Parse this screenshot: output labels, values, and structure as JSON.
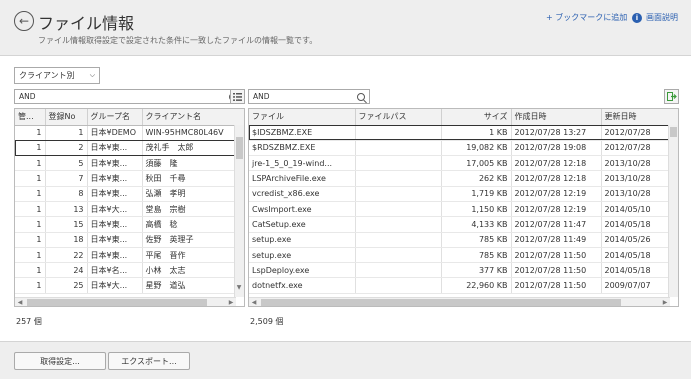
{
  "header": {
    "title": "ファイル情報",
    "subtitle": "ファイル情報取得設定で設定された条件に一致したファイルの情報一覧です。",
    "bookmark_link": "+ ブックマークに追加",
    "help_link": "画面説明"
  },
  "left": {
    "select_value": "クライアント別",
    "search_value": "AND",
    "columns": [
      "管...",
      "登録No",
      "グループ名",
      "クライアント名"
    ],
    "rows": [
      [
        "1",
        "1",
        "日本¥DEMO",
        "WIN-95HMC80L46V"
      ],
      [
        "1",
        "2",
        "日本¥東...",
        "茂礼手　太郎"
      ],
      [
        "1",
        "5",
        "日本¥東...",
        "須藤　隆"
      ],
      [
        "1",
        "7",
        "日本¥東...",
        "秋田　千尋"
      ],
      [
        "1",
        "8",
        "日本¥東...",
        "弘瀬　孝明"
      ],
      [
        "1",
        "13",
        "日本¥大...",
        "堂島　宗樹"
      ],
      [
        "1",
        "15",
        "日本¥東...",
        "高橋　稔"
      ],
      [
        "1",
        "18",
        "日本¥東...",
        "佐野　英理子"
      ],
      [
        "1",
        "22",
        "日本¥東...",
        "平尾　晋作"
      ],
      [
        "1",
        "24",
        "日本¥名...",
        "小林　太志"
      ],
      [
        "1",
        "25",
        "日本¥大...",
        "星野　道弘"
      ]
    ],
    "count": "257 個"
  },
  "right": {
    "search_value": "AND",
    "columns": [
      "ファイル",
      "ファイルパス",
      "サイズ",
      "作成日時",
      "更新日時"
    ],
    "rows": [
      [
        "$IDSZBMZ.EXE",
        "",
        "1 KB",
        "2012/07/28 13:27",
        "2012/07/28"
      ],
      [
        "$RDSZBMZ.EXE",
        "",
        "19,082 KB",
        "2012/07/28 19:08",
        "2012/07/28"
      ],
      [
        "jre-1_5_0_19-wind...",
        "",
        "17,005 KB",
        "2012/07/28 12:18",
        "2013/10/28"
      ],
      [
        "LSPArchiveFile.exe",
        "",
        "262 KB",
        "2012/07/28 12:18",
        "2013/10/28"
      ],
      [
        "vcredist_x86.exe",
        "",
        "1,719 KB",
        "2012/07/28 12:19",
        "2013/10/28"
      ],
      [
        "CwsImport.exe",
        "",
        "1,150 KB",
        "2012/07/28 12:19",
        "2014/05/10"
      ],
      [
        "CatSetup.exe",
        "",
        "4,133 KB",
        "2012/07/28 11:47",
        "2014/05/18"
      ],
      [
        "setup.exe",
        "",
        "785 KB",
        "2012/07/28 11:49",
        "2014/05/26"
      ],
      [
        "setup.exe",
        "",
        "785 KB",
        "2012/07/28 11:50",
        "2014/05/18"
      ],
      [
        "LspDeploy.exe",
        "",
        "377 KB",
        "2012/07/28 11:50",
        "2014/05/18"
      ],
      [
        "dotnetfx.exe",
        "",
        "22,960 KB",
        "2012/07/28 11:50",
        "2009/07/07"
      ]
    ],
    "count": "2,509 個"
  },
  "footer": {
    "acquire_button": "取得設定...",
    "export_button": "エクスポート..."
  },
  "colors": {
    "link": "#2a5fb0",
    "header_bg": "#eeeeee",
    "export_icon": "#3a9a3a"
  }
}
